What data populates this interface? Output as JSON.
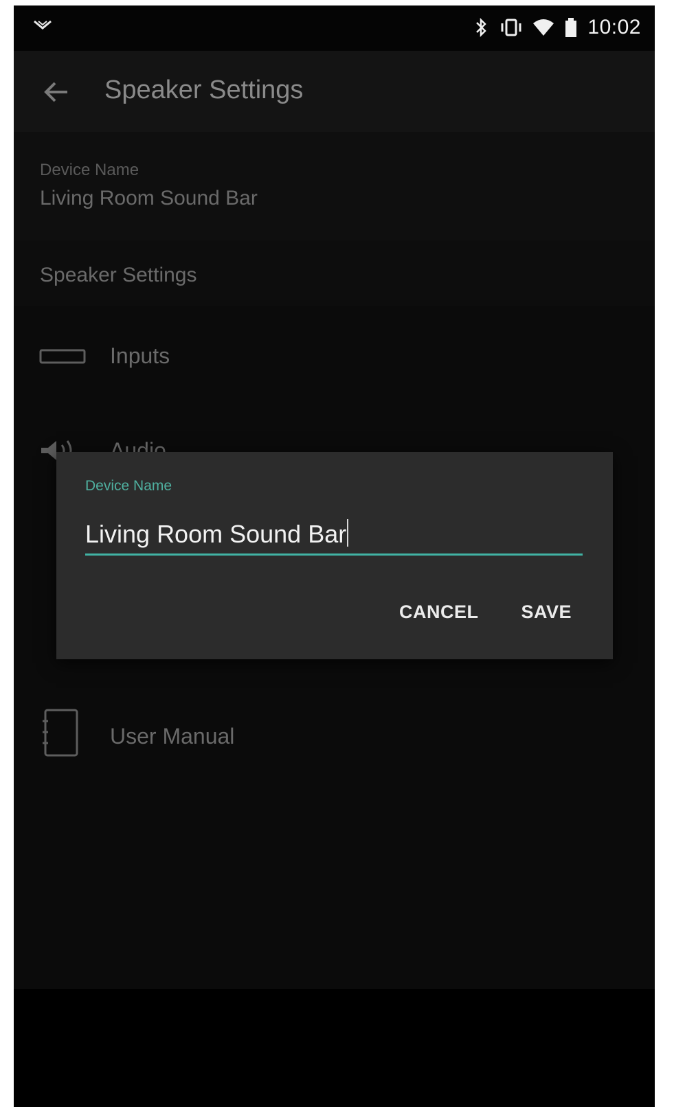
{
  "status_bar": {
    "time": "10:02",
    "icons": [
      "notification-arrow-icon",
      "bluetooth-icon",
      "vibrate-icon",
      "wifi-icon",
      "battery-icon"
    ]
  },
  "app_bar": {
    "back_icon": "back-arrow-icon",
    "title": "Speaker Settings"
  },
  "device": {
    "label": "Device Name",
    "value": "Living Room Sound Bar"
  },
  "section": {
    "title": "Speaker Settings"
  },
  "list": {
    "items": [
      {
        "label": "Inputs",
        "icon": "input-icon"
      },
      {
        "label": "Audio",
        "icon": "speaker-icon"
      },
      {
        "label": "User Manual",
        "icon": "manual-icon"
      }
    ]
  },
  "dialog": {
    "field_label": "Device Name",
    "field_value": "Living Room Sound Bar",
    "cancel_label": "CANCEL",
    "save_label": "SAVE"
  },
  "colors": {
    "accent": "#41b3a4",
    "dialog_bg": "#2c2c2c",
    "screen_bg": "#0b0b0b"
  }
}
